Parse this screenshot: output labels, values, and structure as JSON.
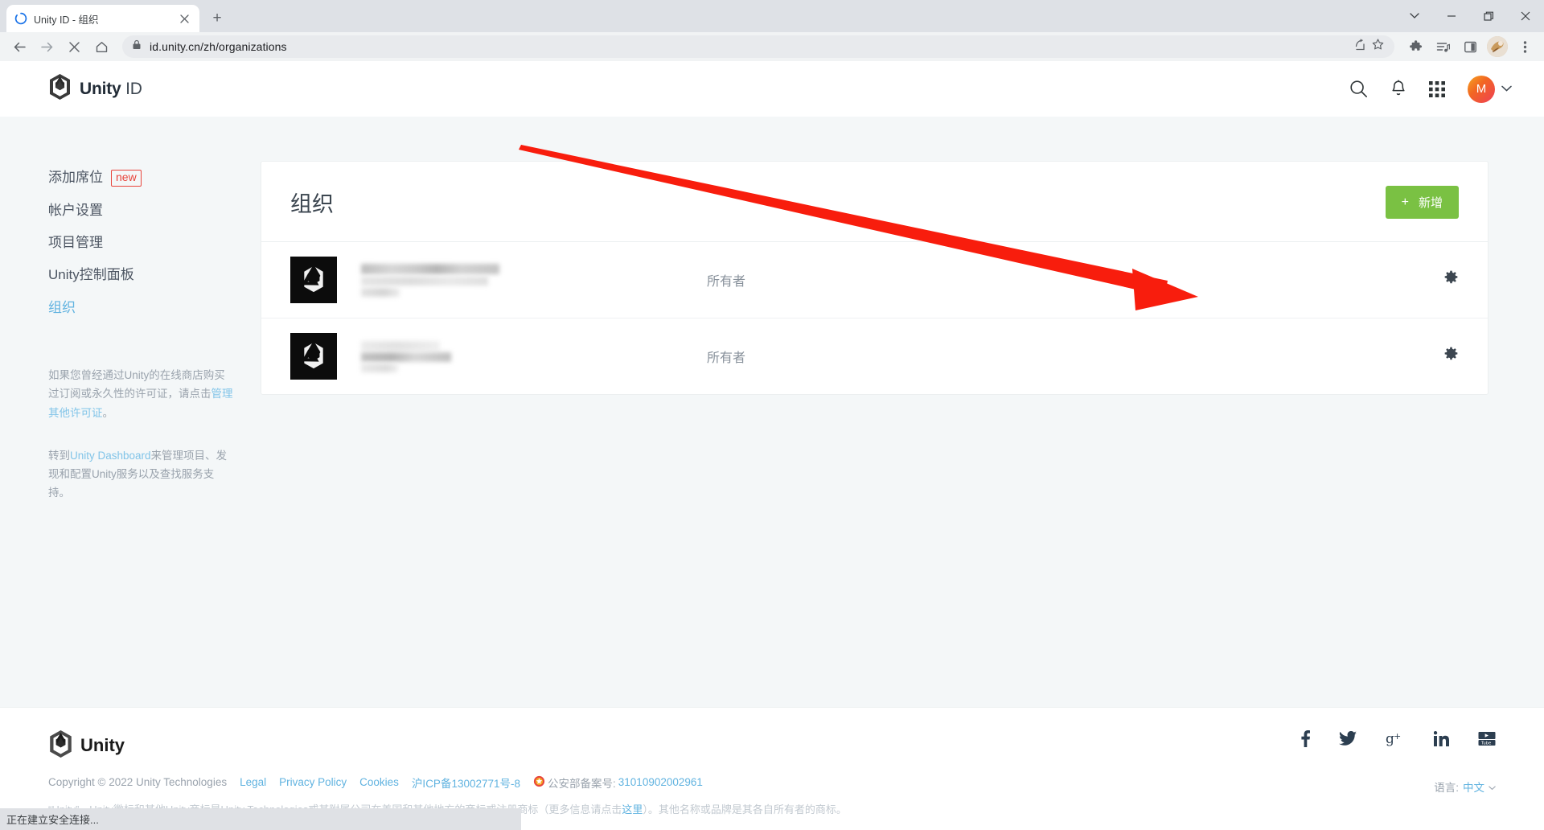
{
  "browser": {
    "tab": {
      "title": "Unity ID - 组织",
      "spinner_icon": "loading-spinner-icon",
      "close_icon": "close-icon"
    },
    "new_tab_label": "+",
    "window_controls": {
      "minimize": "—",
      "maximize": "❐",
      "close": "✕",
      "expand": "⌄"
    },
    "nav": {
      "back_icon": "back-arrow-icon",
      "forward_icon": "forward-arrow-icon",
      "stop_icon": "stop-x-icon",
      "home_icon": "home-icon"
    },
    "omnibox": {
      "lock_icon": "lock-icon",
      "url": "id.unity.cn/zh/organizations",
      "share_icon": "share-icon",
      "bookmark_icon": "star-icon"
    },
    "toolbar_right": {
      "extensions_icon": "puzzle-extensions-icon",
      "media_icon": "media-list-icon",
      "sidepanel_icon": "side-panel-icon",
      "profile_icon": "chrome-profile-avatar",
      "menu_icon": "three-dot-menu-icon"
    },
    "status": "正在建立安全连接..."
  },
  "header": {
    "brand_bold": "Unity",
    "brand_light": "ID",
    "logo_icon": "unity-cube-logo-icon",
    "search_icon": "search-icon",
    "bell_icon": "notification-bell-icon",
    "apps_icon": "apps-grid-icon",
    "avatar_initial": "M",
    "avatar_chevron": "chevron-down-icon"
  },
  "sidebar": {
    "items": [
      {
        "label": "添加席位",
        "badge": "new",
        "active": false
      },
      {
        "label": "帐户设置",
        "badge": "",
        "active": false
      },
      {
        "label": "项目管理",
        "badge": "",
        "active": false
      },
      {
        "label": "Unity控制面板",
        "badge": "",
        "active": false
      },
      {
        "label": "组织",
        "badge": "",
        "active": true
      }
    ],
    "note1_before": "如果您曾经通过Unity的在线商店购买过订阅或永久性的许可证，请点击",
    "note1_link": "管理其他许可证",
    "note1_after": "。",
    "note2_before": "转到",
    "note2_link": "Unity Dashboard",
    "note2_after": "来管理项目、发现和配置Unity服务以及查找服务支持。"
  },
  "main": {
    "card_title": "组织",
    "new_button": {
      "plus": "+",
      "label": "新增"
    },
    "role_column_label": "所有者",
    "organizations": [
      {
        "logo_icon": "unity-cube-logo-icon",
        "name_redacted": true,
        "role": "所有者",
        "gear_icon": "gear-icon"
      },
      {
        "logo_icon": "unity-cube-logo-icon",
        "name_redacted": true,
        "role": "所有者",
        "gear_icon": "gear-icon"
      }
    ]
  },
  "footer": {
    "logo_text": "Unity",
    "logo_icon": "unity-cube-logo-icon",
    "copyright": "Copyright © 2022 Unity Technologies",
    "links": [
      {
        "label": "Legal"
      },
      {
        "label": "Privacy Policy"
      },
      {
        "label": "Cookies"
      },
      {
        "label": "沪ICP备13002771号-8"
      }
    ],
    "gov_icon": "police-badge-icon",
    "gov_label": "公安部备案号:",
    "gov_number": "31010902002961",
    "legal_before": "“Unity”、Unity徽标和其他Unity商标是Unity Technologies或其附属公司在美国和其他地方的商标或注册商标（更多信息请点击",
    "legal_link": "这里",
    "legal_after": "）。其他名称或品牌是其各自所有者的商标。",
    "social": [
      {
        "icon": "facebook-icon"
      },
      {
        "icon": "twitter-icon"
      },
      {
        "icon": "google-plus-icon"
      },
      {
        "icon": "linkedin-icon"
      },
      {
        "icon": "youtube-icon"
      }
    ],
    "language_label": "语言:",
    "language_value": "中文",
    "language_chevron": "chevron-down-icon"
  },
  "annotation": {
    "arrow_color": "#f81d0d",
    "arrow_from": "648,106",
    "arrow_to": "1485,292"
  },
  "colors": {
    "accent_green": "#7ac143",
    "link_blue": "#61b3e0",
    "page_bg": "#f4f7f8",
    "badge_red": "#e8453c"
  }
}
